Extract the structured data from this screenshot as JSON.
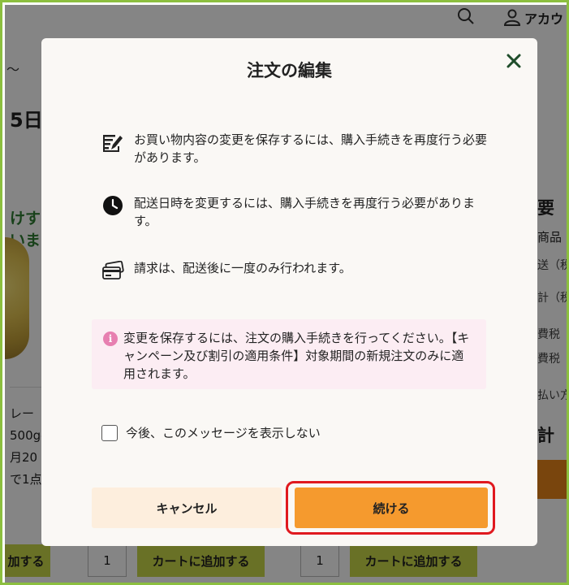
{
  "background": {
    "account_label": "アカウ",
    "date_fragment": "5日",
    "promo_line1": "けする",
    "promo_line2": "います",
    "product_line1": "レー",
    "product_line2": "500g-",
    "product_line3": "月20",
    "product_line4": "で1点",
    "right_summary": {
      "heading": "要",
      "line1": "商品",
      "line2": "送（税",
      "line3": "計（税",
      "line4": "費税",
      "line5": "費税",
      "line6": "払い方",
      "total": "計"
    },
    "add_to_cart_label": "カートに追加する",
    "add_to_cart_fragment": "加する",
    "quantity_value": "1"
  },
  "modal": {
    "title": "注文の編集",
    "close_label": "✕",
    "info_items": [
      {
        "icon": "edit-icon",
        "text": "お買い物内容の変更を保存するには、購入手続きを再度行う必要があります。"
      },
      {
        "icon": "clock-icon",
        "text": "配送日時を変更するには、購入手続きを再度行う必要があります。"
      },
      {
        "icon": "credit-card-icon",
        "text": "請求は、配送後に一度のみ行われます。"
      }
    ],
    "notice": {
      "icon": "info-icon",
      "icon_glyph": "i",
      "text": "変更を保存するには、注文の購入手続きを行ってください。【キャンペーン及び割引の適用条件】対象期間の新規注文のみに適用されます。"
    },
    "checkbox_label": "今後、このメッセージを表示しない",
    "cancel_label": "キャンセル",
    "continue_label": "続ける"
  },
  "colors": {
    "frame_border": "#8cbf3f",
    "continue_button": "#f59a2e",
    "cancel_button": "#fdeedd",
    "highlight_ring": "#e0191f",
    "notice_background": "#fcedf3",
    "close_icon": "#1f4d2b"
  }
}
